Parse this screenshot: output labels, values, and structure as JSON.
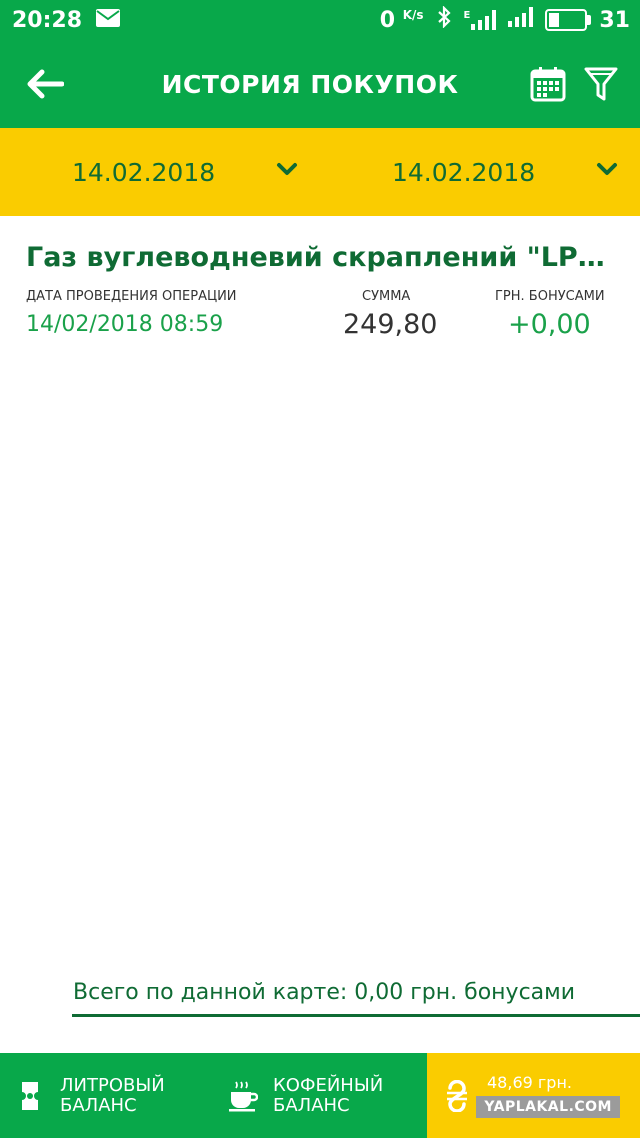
{
  "status": {
    "time": "20:28",
    "speed": "0",
    "speed_unit": "K/s",
    "net": "E",
    "battery": "31"
  },
  "header": {
    "title": "ИСТОРИЯ ПОКУПОК"
  },
  "filters": {
    "date_from": "14.02.2018",
    "date_to": "14.02.2018"
  },
  "transactions": [
    {
      "name": "Газ вуглеводневий  скраплений \"LPG M...",
      "date_label": "ДАТА ПРОВЕДЕНИЯ ОПЕРАЦИИ",
      "date": "14/02/2018 08:59",
      "sum_label": "СУММА",
      "sum": "249,80",
      "bonus_label": "ГРН. БОНУСАМИ",
      "bonus": "+0,00"
    }
  ],
  "summary": {
    "total": "Всего по данной карте: 0,00 грн. бонусами"
  },
  "bottom_nav": {
    "liter_line1": "ЛИТРОВЫЙ",
    "liter_line2": "БАЛАНС",
    "coffee_line1": "КОФЕЙНЫЙ",
    "coffee_line2": "БАЛАНС",
    "money": "48,69 грн.",
    "watermark": "YAPLAKAL.COM"
  },
  "colors": {
    "primary_green": "#08a84a",
    "dark_green": "#0f6b34",
    "yellow": "#facc00"
  }
}
